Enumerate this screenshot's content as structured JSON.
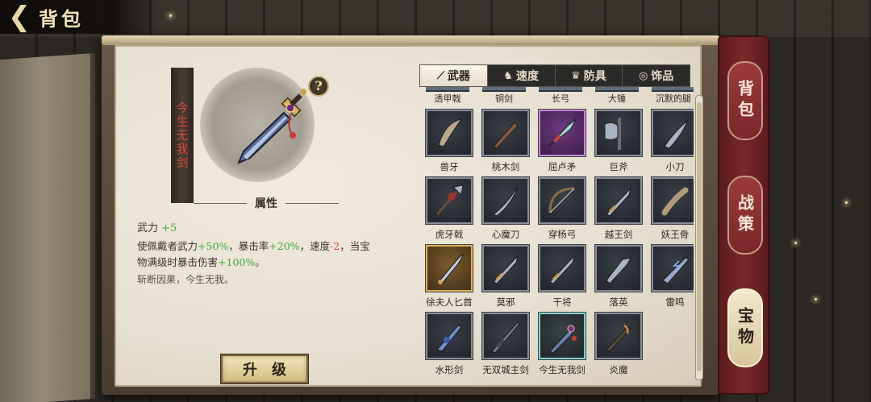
{
  "header": {
    "back_icon": "back-arrow-icon",
    "title": "背包"
  },
  "detail": {
    "name": "今生无我剑",
    "help_label": "?",
    "attr_section_title": "属性",
    "stat_label": "武力",
    "stat_value": "+5",
    "desc_parts": {
      "p1": "使佩戴者武力",
      "v1": "+50%",
      "p2": "，暴击率",
      "v2": "+20%",
      "p3": "，速度",
      "v3": "-2",
      "p4": "，当宝物满级时暴击伤害",
      "v4": "+100%",
      "p5": "。"
    },
    "flavor": "斩断因果，今生无我。",
    "upgrade_label": "升级"
  },
  "tabs": [
    {
      "label": "武器",
      "icon": "weapon-icon",
      "active": true
    },
    {
      "label": "速度",
      "icon": "horse-icon",
      "active": false
    },
    {
      "label": "防具",
      "icon": "armor-icon",
      "active": false
    },
    {
      "label": "饰品",
      "icon": "ring-icon",
      "active": false
    }
  ],
  "cut_row_labels": [
    "透甲戟",
    "铜剑",
    "长弓",
    "大锤",
    "沉默的腿"
  ],
  "items": [
    {
      "label": "兽牙",
      "rarity": "normal",
      "icon": "fang-blade-icon"
    },
    {
      "label": "桃木剑",
      "rarity": "normal",
      "icon": "wooden-sword-icon"
    },
    {
      "label": "屈卢矛",
      "rarity": "purple",
      "icon": "spear-head-icon"
    },
    {
      "label": "巨斧",
      "rarity": "normal",
      "icon": "great-axe-icon"
    },
    {
      "label": "小刀",
      "rarity": "normal",
      "icon": "knife-icon"
    },
    {
      "label": "虎牙戟",
      "rarity": "normal",
      "icon": "halberd-icon"
    },
    {
      "label": "心魔刀",
      "rarity": "normal",
      "icon": "saber-icon"
    },
    {
      "label": "穿杨弓",
      "rarity": "normal",
      "icon": "bow-icon"
    },
    {
      "label": "越王剑",
      "rarity": "normal",
      "icon": "sword-icon"
    },
    {
      "label": "妖王骨",
      "rarity": "normal",
      "icon": "bone-club-icon"
    },
    {
      "label": "徐夫人匕首",
      "rarity": "gold",
      "icon": "dagger-icon"
    },
    {
      "label": "莫邪",
      "rarity": "normal",
      "icon": "sword-icon"
    },
    {
      "label": "干将",
      "rarity": "normal",
      "icon": "sword-icon"
    },
    {
      "label": "落英",
      "rarity": "normal",
      "icon": "blade-icon"
    },
    {
      "label": "雷鸣",
      "rarity": "normal",
      "icon": "thunder-blade-icon"
    },
    {
      "label": "水形剑",
      "rarity": "normal",
      "icon": "water-sword-icon"
    },
    {
      "label": "无双城主剑",
      "rarity": "normal",
      "icon": "long-sword-icon"
    },
    {
      "label": "今生无我剑",
      "rarity": "selected",
      "icon": "jeweled-sword-icon"
    },
    {
      "label": "炎魔",
      "rarity": "normal",
      "icon": "flame-blade-icon"
    }
  ],
  "side_tabs": [
    {
      "label": "背包",
      "active": false
    },
    {
      "label": "战策",
      "active": false
    },
    {
      "label": "宝物",
      "active": true
    }
  ],
  "colors": {
    "bonus_green": "#3fa53a",
    "penalty_red": "#d1402f",
    "name_red": "#d9493c",
    "side_tab_red": "#7a2727"
  }
}
